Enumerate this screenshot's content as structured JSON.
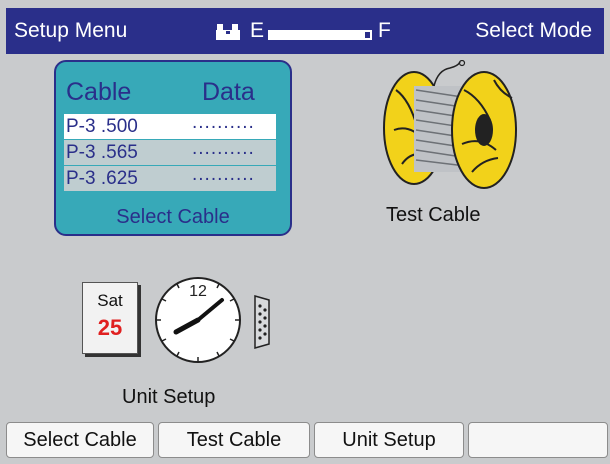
{
  "header": {
    "title": "Setup Menu",
    "mode": "Select Mode",
    "fuel_empty_label": "E",
    "fuel_full_label": "F",
    "fuel_level": 0.95
  },
  "cable_panel": {
    "col_cable": "Cable",
    "col_data": "Data",
    "rows": [
      {
        "name": "P-3 .500",
        "data": ".........."
      },
      {
        "name": "P-3 .565",
        "data": ".........."
      },
      {
        "name": "P-3 .625",
        "data": ".........."
      }
    ],
    "label": "Select Cable"
  },
  "test_cable": {
    "label": "Test Cable"
  },
  "unit_setup": {
    "calendar_day": "Sat",
    "calendar_date": "25",
    "clock_numeral": "12",
    "label": "Unit Setup"
  },
  "softkeys": [
    "Select Cable",
    "Test Cable",
    "Unit Setup",
    ""
  ],
  "colors": {
    "header_bg": "#2a2f8a",
    "panel_bg": "#c9cbcd",
    "cable_box_bg": "#37a9b8",
    "calendar_date": "#e02020"
  },
  "icons": [
    "battery-icon",
    "cable-spool-icon",
    "calendar-icon",
    "clock-icon",
    "serial-port-icon"
  ]
}
